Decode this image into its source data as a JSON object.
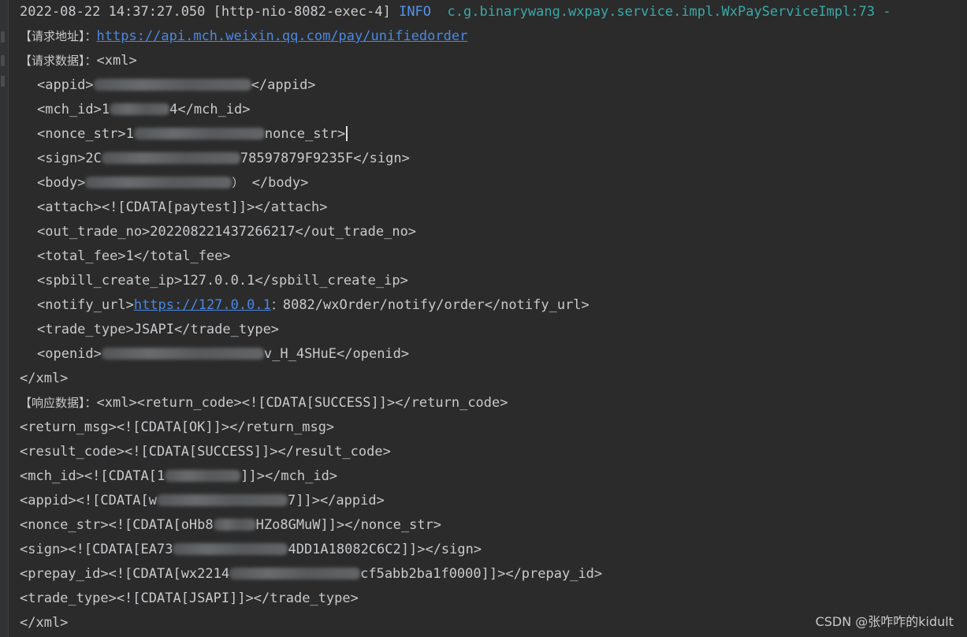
{
  "log_header": {
    "timestamp": "2022-08-22 14:37:27.050",
    "thread": "[http-nio-8082-exec-4]",
    "level": "INFO",
    "logger": "c.g.binarywang.wxpay.service.impl.WxPayServiceImpl:73 -"
  },
  "request_address": {
    "label": "【请求地址】：",
    "url": "https://api.mch.weixin.qq.com/pay/unifiedorder"
  },
  "request_data": {
    "label": "【请求数据】：",
    "xml_open": "<xml>",
    "appid_open": "<appid>",
    "appid_close": "</appid>",
    "mch_id_open": "<mch_id>",
    "mch_id_visible_start": "1",
    "mch_id_visible_end": "4",
    "mch_id_close": "</mch_id>",
    "nonce_str_open": "<nonce_str>",
    "nonce_str_visible_start": "1",
    "nonce_str_close": "nonce_str>",
    "sign_open": "<sign>",
    "sign_visible_start": "2C",
    "sign_visible_end": "78597879F9235F",
    "sign_close": "</sign>",
    "body_open": "<body>",
    "body_visible_end": "）",
    "body_close": "</body>",
    "attach": "<attach><![CDATA[paytest]]></attach>",
    "out_trade_no": "<out_trade_no>202208221437266217</out_trade_no>",
    "total_fee": "<total_fee>1</total_fee>",
    "spbill_create_ip": "<spbill_create_ip>127.0.0.1</spbill_create_ip>",
    "notify_url_open": "<notify_url>",
    "notify_url_link": "https://127.0.0.1",
    "notify_url_colon": "：",
    "notify_url_rest": "8082/wxOrder/notify/order",
    "notify_url_close": "</notify_url>",
    "trade_type": "<trade_type>JSAPI</trade_type>",
    "openid_open": "<openid>",
    "openid_visible_end": "v_H_4SHuE",
    "openid_close": "</openid>",
    "xml_close": "</xml>"
  },
  "response_data": {
    "label": "【响应数据】：",
    "return_code": "<xml><return_code><![CDATA[SUCCESS]]></return_code>",
    "return_msg": "<return_msg><![CDATA[OK]]></return_msg>",
    "result_code": "<result_code><![CDATA[SUCCESS]]></result_code>",
    "mch_id_open": "<mch_id><![CDATA[1",
    "mch_id_close": "]]></mch_id>",
    "appid_open": "<appid><![CDATA[w",
    "appid_close": "7]]></appid>",
    "nonce_str_open": "<nonce_str><![CDATA[oHb8",
    "nonce_str_close": "HZo8GMuW]]></nonce_str>",
    "sign_open": "<sign><![CDATA[EA73",
    "sign_close": "4DD1A18082C6C2]]></sign>",
    "prepay_id_open": "<prepay_id><![CDATA[wx2214",
    "prepay_id_close": "cf5abb2ba1f0000]]></prepay_id>",
    "trade_type": "<trade_type><![CDATA[JSAPI]]></trade_type>",
    "xml_close": "</xml>"
  },
  "watermark": "CSDN @张咋咋的kidult"
}
